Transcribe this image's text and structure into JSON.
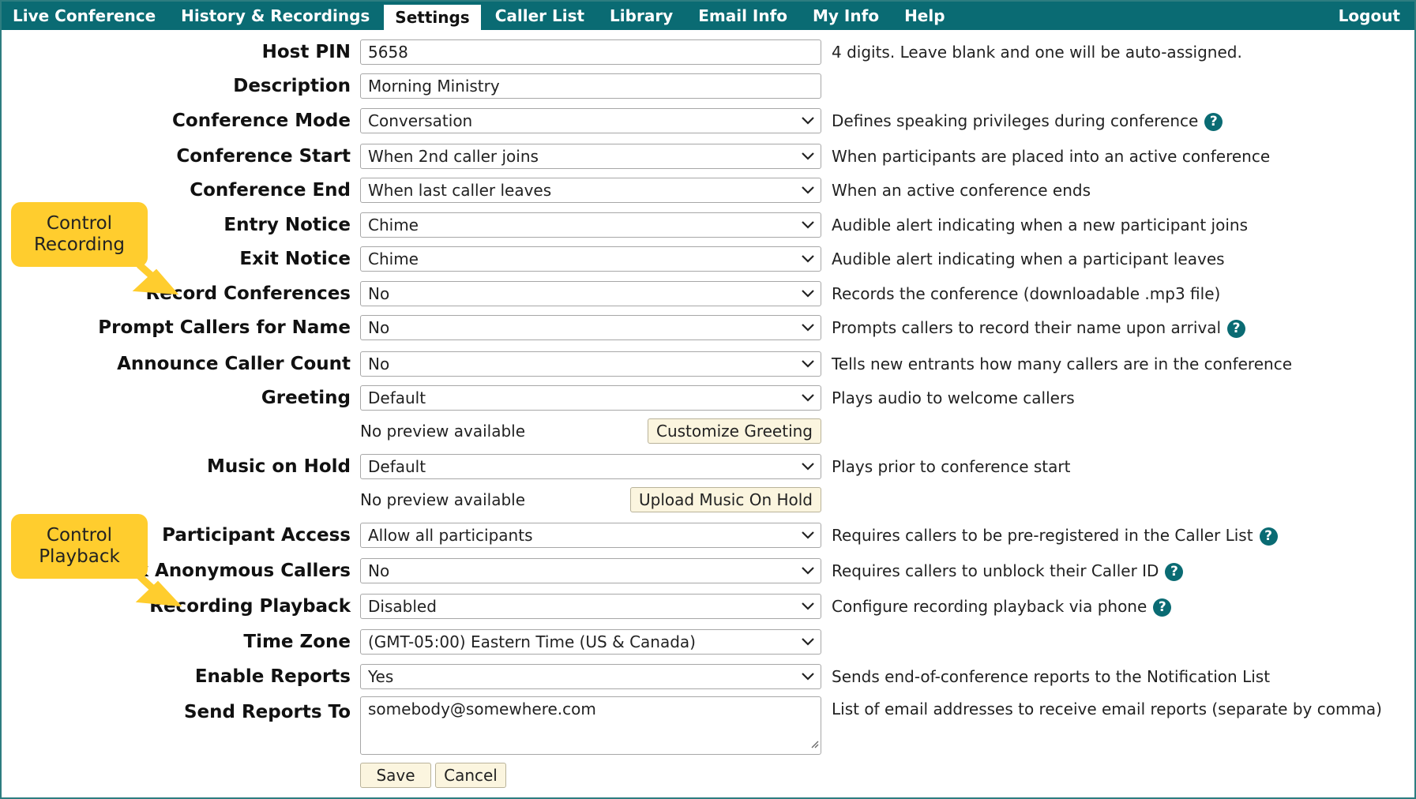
{
  "nav": {
    "tabs": [
      {
        "label": "Live Conference"
      },
      {
        "label": "History & Recordings"
      },
      {
        "label": "Settings"
      },
      {
        "label": "Caller List"
      },
      {
        "label": "Library"
      },
      {
        "label": "Email Info"
      },
      {
        "label": "My Info"
      },
      {
        "label": "Help"
      }
    ],
    "active_tab": "Settings",
    "logout": "Logout"
  },
  "form": {
    "host_pin": {
      "label": "Host PIN",
      "value": "5658",
      "help": "4 digits. Leave blank and one will be auto-assigned."
    },
    "description": {
      "label": "Description",
      "value": "Morning Ministry"
    },
    "conference_mode": {
      "label": "Conference Mode",
      "value": "Conversation",
      "help": "Defines speaking privileges during conference"
    },
    "conference_start": {
      "label": "Conference Start",
      "value": "When 2nd caller joins",
      "help": "When participants are placed into an active conference"
    },
    "conference_end": {
      "label": "Conference End",
      "value": "When last caller leaves",
      "help": "When an active conference ends"
    },
    "entry_notice": {
      "label": "Entry Notice",
      "value": "Chime",
      "help": "Audible alert indicating when a new participant joins"
    },
    "exit_notice": {
      "label": "Exit Notice",
      "value": "Chime",
      "help": "Audible alert indicating when a participant leaves"
    },
    "record_conferences": {
      "label": "Record Conferences",
      "value": "No",
      "help": "Records the conference (downloadable .mp3 file)"
    },
    "prompt_name": {
      "label": "Prompt Callers for Name",
      "value": "No",
      "help": "Prompts callers to record their name upon arrival"
    },
    "announce_count": {
      "label": "Announce Caller Count",
      "value": "No",
      "help": "Tells new entrants how many callers are in the conference"
    },
    "greeting": {
      "label": "Greeting",
      "value": "Default",
      "help": "Plays audio to welcome callers",
      "preview": "No preview available",
      "button": "Customize Greeting"
    },
    "music_on_hold": {
      "label": "Music on Hold",
      "value": "Default",
      "help": "Plays prior to conference start",
      "preview": "No preview available",
      "button": "Upload Music On Hold"
    },
    "participant_access": {
      "label": "Participant Access",
      "value": "Allow all participants",
      "help": "Requires callers to be pre-registered in the Caller List"
    },
    "block_anonymous": {
      "label": "Block Anonymous Callers",
      "value": "No",
      "help": "Requires callers to unblock their Caller ID"
    },
    "recording_playback": {
      "label": "Recording Playback",
      "value": "Disabled",
      "help": "Configure recording playback via phone"
    },
    "time_zone": {
      "label": "Time Zone",
      "value": "(GMT-05:00) Eastern Time (US & Canada)"
    },
    "enable_reports": {
      "label": "Enable Reports",
      "value": "Yes",
      "help": "Sends end-of-conference reports to the Notification List"
    },
    "send_reports_to": {
      "label": "Send Reports To",
      "value": "somebody@somewhere.com",
      "help": "List of email addresses to receive email reports (separate by comma)"
    }
  },
  "actions": {
    "save": "Save",
    "cancel": "Cancel"
  },
  "callouts": {
    "recording": {
      "line1": "Control",
      "line2": "Recording"
    },
    "playback": {
      "line1": "Control",
      "line2": "Playback"
    }
  },
  "icons": {
    "help": "question-circle-icon",
    "dropdown": "chevron-down-icon",
    "resize": "resize-grip-icon"
  },
  "colors": {
    "nav_bg": "#0a6b73",
    "help_icon": "#0a6b73",
    "callout": "#ffcd2e",
    "button_bg": "#fbf5df"
  }
}
